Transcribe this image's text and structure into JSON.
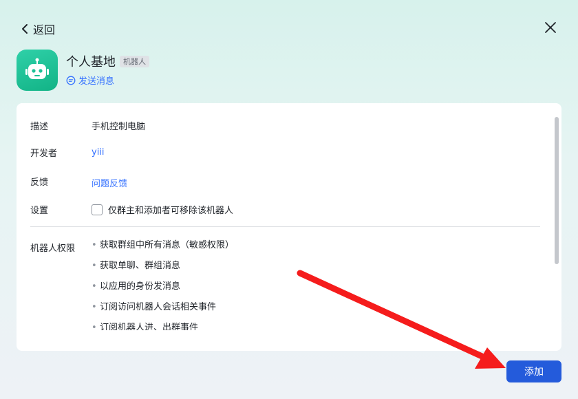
{
  "header": {
    "back_label": "返回"
  },
  "app": {
    "name": "个人基地",
    "badge": "机器人",
    "send_message": "发送消息"
  },
  "info": {
    "rows": [
      {
        "label": "描述",
        "value": "手机控制电脑"
      },
      {
        "label": "开发者",
        "value": "yiii"
      },
      {
        "label": "反馈",
        "value": "问题反馈"
      },
      {
        "label": "设置",
        "value": "仅群主和添加者可移除该机器人"
      }
    ]
  },
  "permissions": {
    "title": "机器人权限",
    "items": [
      "获取群组中所有消息（敏感权限）",
      "获取单聊、群组消息",
      "以应用的身份发消息",
      "订阅访问机器人会话相关事件",
      "订阅机器人进、出群事件"
    ]
  },
  "footer": {
    "add_label": "添加"
  },
  "colors": {
    "accent": "#245bdb",
    "link": "#3370ff",
    "icon_green": "#1cc196",
    "annotation_arrow": "#f51c1c"
  }
}
